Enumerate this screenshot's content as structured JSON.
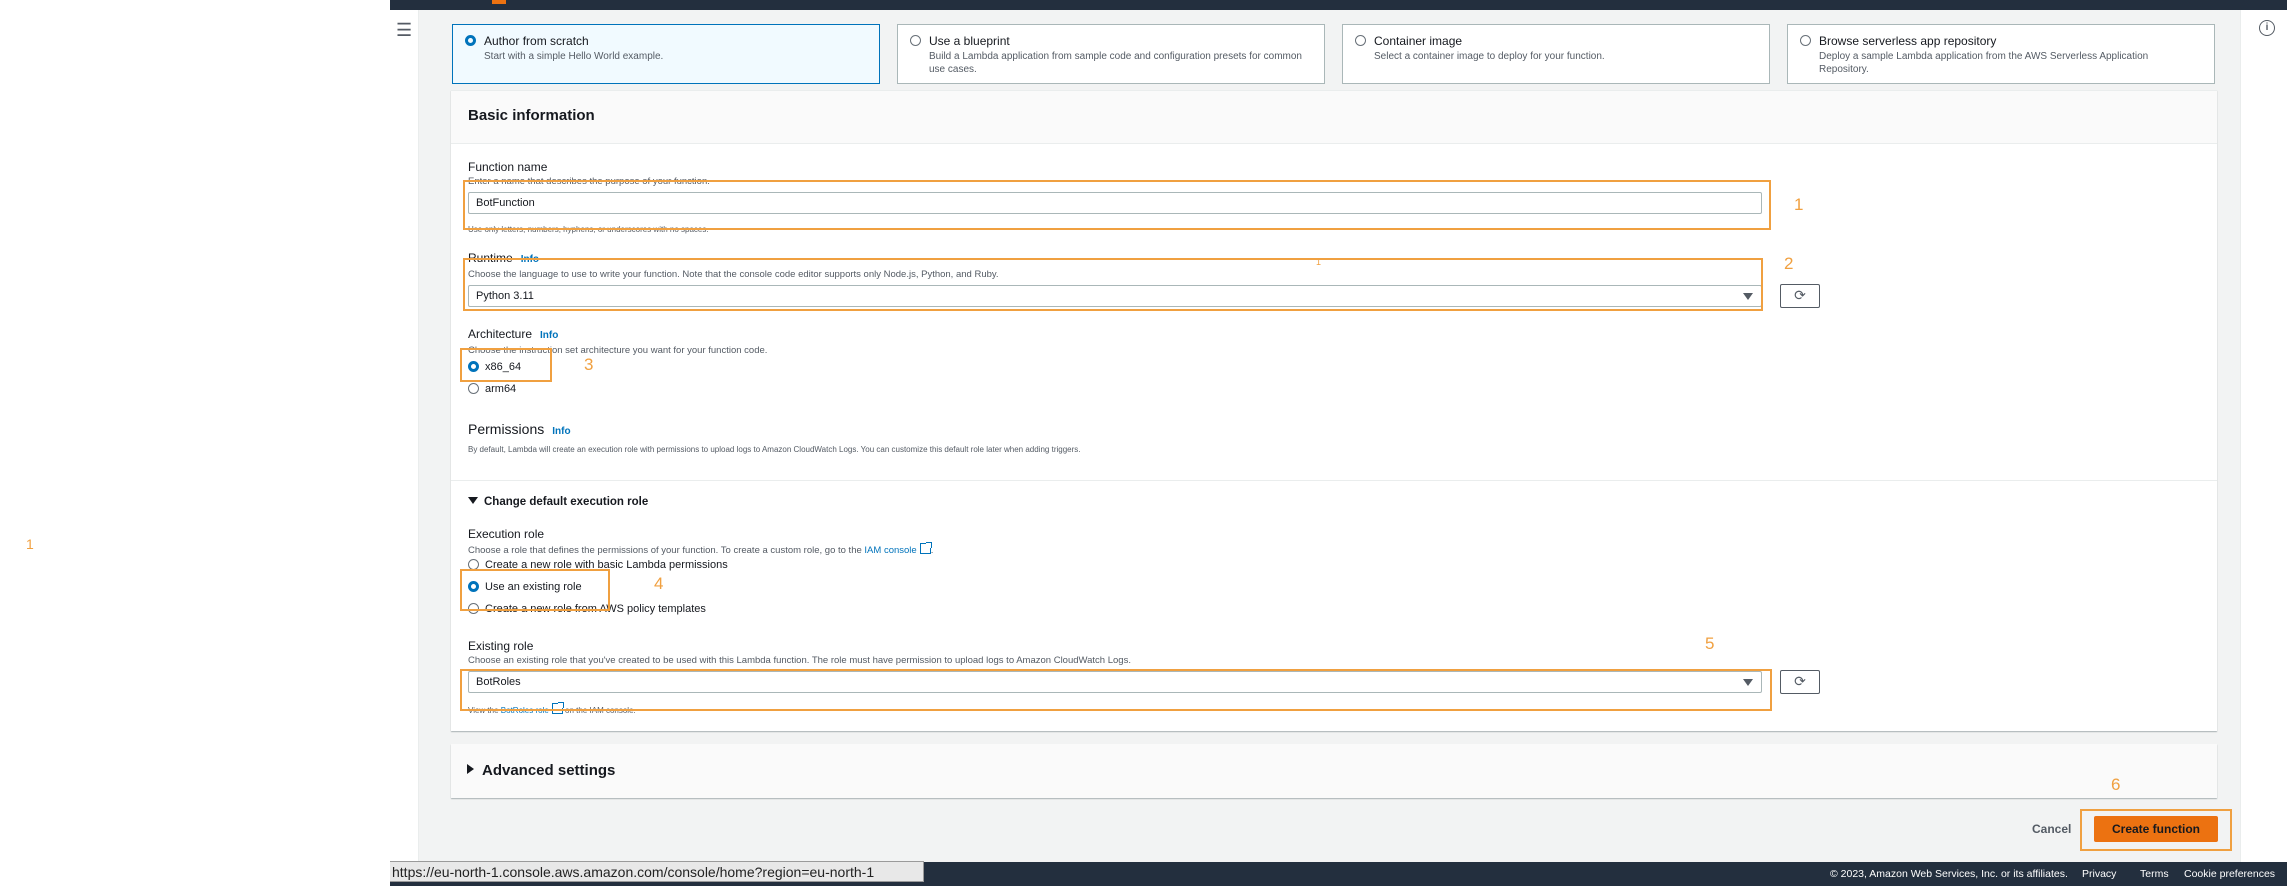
{
  "annotations": {
    "left_marker": "1",
    "n1": "1",
    "n2": "2",
    "n3": "3",
    "n4": "4",
    "n5": "5",
    "n6": "6",
    "runtime_stray": "1"
  },
  "options": [
    {
      "title": "Author from scratch",
      "desc": "Start with a simple Hello World example.",
      "selected": true
    },
    {
      "title": "Use a blueprint",
      "desc": "Build a Lambda application from sample code and configuration presets for common use cases.",
      "selected": false
    },
    {
      "title": "Container image",
      "desc": "Select a container image to deploy for your function.",
      "selected": false
    },
    {
      "title": "Browse serverless app repository",
      "desc": "Deploy a sample Lambda application from the AWS Serverless Application Repository.",
      "selected": false
    }
  ],
  "basic": {
    "title": "Basic information",
    "function_name_label": "Function name",
    "function_name_hint": "Enter a name that describes the purpose of your function.",
    "function_name_value": "BotFunction",
    "function_name_constraint": "Use only letters, numbers, hyphens, or underscores with no spaces.",
    "runtime_label": "Runtime",
    "info": "Info",
    "runtime_hint": "Choose the language to use to write your function. Note that the console code editor supports only Node.js, Python, and Ruby.",
    "runtime_value": "Python 3.11",
    "architecture_label": "Architecture",
    "architecture_hint": "Choose the instruction set architecture you want for your function code.",
    "arch_options": [
      "x86_64",
      "arm64"
    ],
    "permissions_label": "Permissions",
    "permissions_hint": "By default, Lambda will create an execution role with permissions to upload logs to Amazon CloudWatch Logs. You can customize this default role later when adding triggers.",
    "change_role_label": "Change default execution role",
    "execution_role_label": "Execution role",
    "execution_role_hint": "Choose a role that defines the permissions of your function. To create a custom role, go to the",
    "iam_console_link": "IAM console",
    "role_options": [
      "Create a new role with basic Lambda permissions",
      "Use an existing role",
      "Create a new role from AWS policy templates"
    ],
    "existing_role_label": "Existing role",
    "existing_role_hint": "Choose an existing role that you've created to be used with this Lambda function. The role must have permission to upload logs to Amazon CloudWatch Logs.",
    "existing_role_value": "BotRoles",
    "view_role_prefix": "View the",
    "view_role_link": "BotRoles role",
    "view_role_suffix": "on the IAM console."
  },
  "advanced": {
    "title": "Advanced settings"
  },
  "actions": {
    "cancel": "Cancel",
    "create": "Create function"
  },
  "footer": {
    "copyright": "© 2023, Amazon Web Services, Inc. or its affiliates.",
    "privacy": "Privacy",
    "terms": "Terms",
    "cookies": "Cookie preferences"
  },
  "statusbar": {
    "url": "https://eu-north-1.console.aws.amazon.com/console/home?region=eu-north-1"
  },
  "colors": {
    "accent": "#0073bb",
    "primary_button": "#ec7211",
    "annotation": "#f0a040",
    "nav_dark": "#232f3e"
  }
}
